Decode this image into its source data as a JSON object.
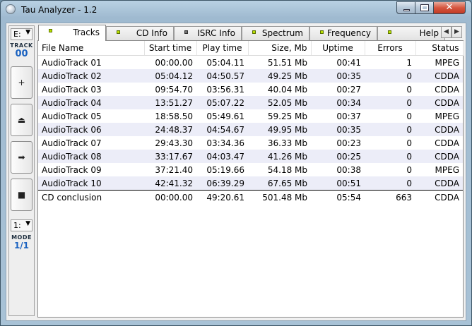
{
  "window": {
    "title": "Tau Analyzer - 1.2"
  },
  "left_panel": {
    "drive_value": "E:",
    "track_label": "TRACK",
    "track_number": "00",
    "buttons": [
      {
        "name": "add-button",
        "glyph": "+"
      },
      {
        "name": "eject-button",
        "glyph": "⏏"
      },
      {
        "name": "forward-button",
        "glyph": "➡"
      },
      {
        "name": "stop-button",
        "glyph": "■"
      }
    ],
    "mode_value": "1:",
    "mode_label": "MODE",
    "mode_number": "1/1"
  },
  "tabs": [
    {
      "label": "Tracks",
      "led": "green",
      "active": true
    },
    {
      "label": "CD Info",
      "led": "green"
    },
    {
      "label": "ISRC Info",
      "led": "gray"
    },
    {
      "label": "Spectrum",
      "led": "green"
    },
    {
      "label": "Frequency",
      "led": "green"
    },
    {
      "label": "Help",
      "led": "green"
    }
  ],
  "table": {
    "columns": [
      "File Name",
      "Start time",
      "Play time",
      "Size, Mb",
      "Uptime",
      "Errors",
      "Status"
    ],
    "rows": [
      [
        "AudioTrack 01",
        "00:00.00",
        "05:04.11",
        "51.51 Mb",
        "00:41",
        "1",
        "MPEG"
      ],
      [
        "AudioTrack 02",
        "05:04.12",
        "04:50.57",
        "49.25 Mb",
        "00:35",
        "0",
        "CDDA"
      ],
      [
        "AudioTrack 03",
        "09:54.70",
        "03:56.31",
        "40.04 Mb",
        "00:27",
        "0",
        "CDDA"
      ],
      [
        "AudioTrack 04",
        "13:51.27",
        "05:07.22",
        "52.05 Mb",
        "00:34",
        "0",
        "CDDA"
      ],
      [
        "AudioTrack 05",
        "18:58.50",
        "05:49.61",
        "59.25 Mb",
        "00:37",
        "0",
        "MPEG"
      ],
      [
        "AudioTrack 06",
        "24:48.37",
        "04:54.67",
        "49.95 Mb",
        "00:35",
        "0",
        "CDDA"
      ],
      [
        "AudioTrack 07",
        "29:43.30",
        "03:34.36",
        "36.33 Mb",
        "00:23",
        "0",
        "CDDA"
      ],
      [
        "AudioTrack 08",
        "33:17.67",
        "04:03.47",
        "41.26 Mb",
        "00:25",
        "0",
        "CDDA"
      ],
      [
        "AudioTrack 09",
        "37:21.40",
        "05:19.66",
        "54.18 Mb",
        "00:38",
        "0",
        "MPEG"
      ],
      [
        "AudioTrack 10",
        "42:41.32",
        "06:39.29",
        "67.65 Mb",
        "00:51",
        "0",
        "CDDA"
      ]
    ],
    "conclusion": [
      "CD conclusion",
      "00:00.00",
      "49:20.61",
      "501.48 Mb",
      "05:54",
      "663",
      "CDDA"
    ]
  }
}
